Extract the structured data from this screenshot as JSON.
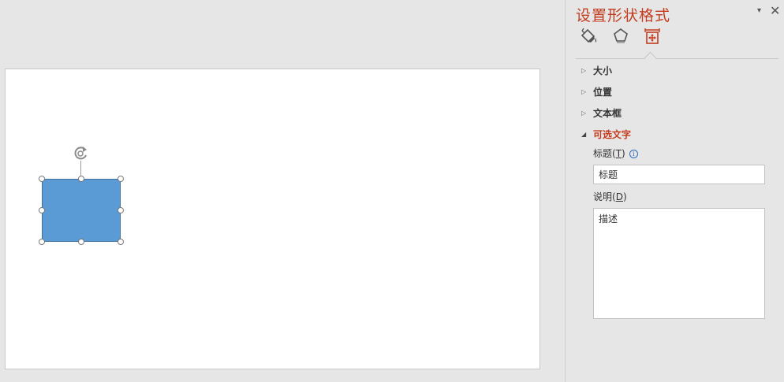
{
  "pane": {
    "title": "设置形状格式",
    "menu_glyph": "▾",
    "close_glyph": "✕",
    "tabs": [
      {
        "name": "fill-line",
        "icon": "paint-bucket-icon"
      },
      {
        "name": "effects",
        "icon": "pentagon-icon"
      },
      {
        "name": "size-properties",
        "icon": "size-layout-icon",
        "active": true
      }
    ],
    "sections": [
      {
        "label": "大小",
        "expanded": false
      },
      {
        "label": "位置",
        "expanded": false
      },
      {
        "label": "文本框",
        "expanded": false
      },
      {
        "label": "可选文字",
        "expanded": true
      }
    ],
    "alt_text": {
      "title_label": "标题",
      "title_key": "T",
      "title_value": "标题",
      "desc_label": "说明",
      "desc_key": "D",
      "desc_value": "描述"
    }
  },
  "colors": {
    "accent": "#c43b1d",
    "shape_fill": "#5b9bd5",
    "shape_border": "#41719c"
  }
}
